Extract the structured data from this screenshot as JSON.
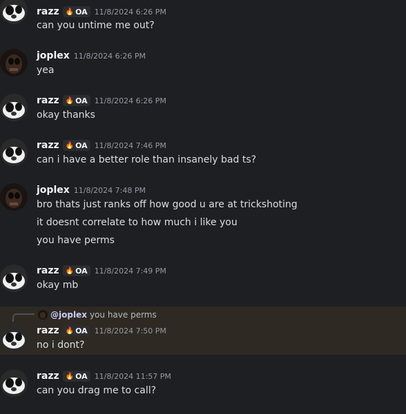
{
  "colors": {
    "background": "#1e1f22",
    "reply_highlight": "#2e2a23",
    "text": "#dbdee1",
    "username": "#f2f3f5",
    "timestamp": "#949ba4",
    "mention": "#c9cdfb"
  },
  "users": {
    "razz": {
      "name": "razz",
      "tag": "OA",
      "tag_icon": "fire-icon"
    },
    "joplex": {
      "name": "joplex"
    }
  },
  "messages": [
    {
      "author": "razz",
      "timestamp": "11/8/2024 6:26 PM",
      "lines": [
        "can you untime me out?"
      ]
    },
    {
      "author": "joplex",
      "timestamp": "11/8/2024 6:26 PM",
      "lines": [
        "yea"
      ]
    },
    {
      "author": "razz",
      "timestamp": "11/8/2024 6:26 PM",
      "lines": [
        "okay thanks"
      ]
    },
    {
      "author": "razz",
      "timestamp": "11/8/2024 7:46 PM",
      "lines": [
        "can i have a better role than insanely bad ts?"
      ]
    },
    {
      "author": "joplex",
      "timestamp": "11/8/2024 7:48 PM",
      "lines": [
        "bro thats just ranks off how good u are at trickshoting",
        "it doesnt correlate to how much i like you",
        "you have perms"
      ]
    },
    {
      "author": "razz",
      "timestamp": "11/8/2024 7:49 PM",
      "lines": [
        "okay mb"
      ]
    },
    {
      "author": "razz",
      "timestamp": "11/8/2024 7:50 PM",
      "lines": [
        "no i dont?"
      ],
      "reply_to": {
        "mention": "@joplex",
        "text": "you have perms"
      }
    },
    {
      "author": "razz",
      "timestamp": "11/8/2024 11:57 PM",
      "lines": [
        "can you drag me to call?"
      ]
    }
  ]
}
